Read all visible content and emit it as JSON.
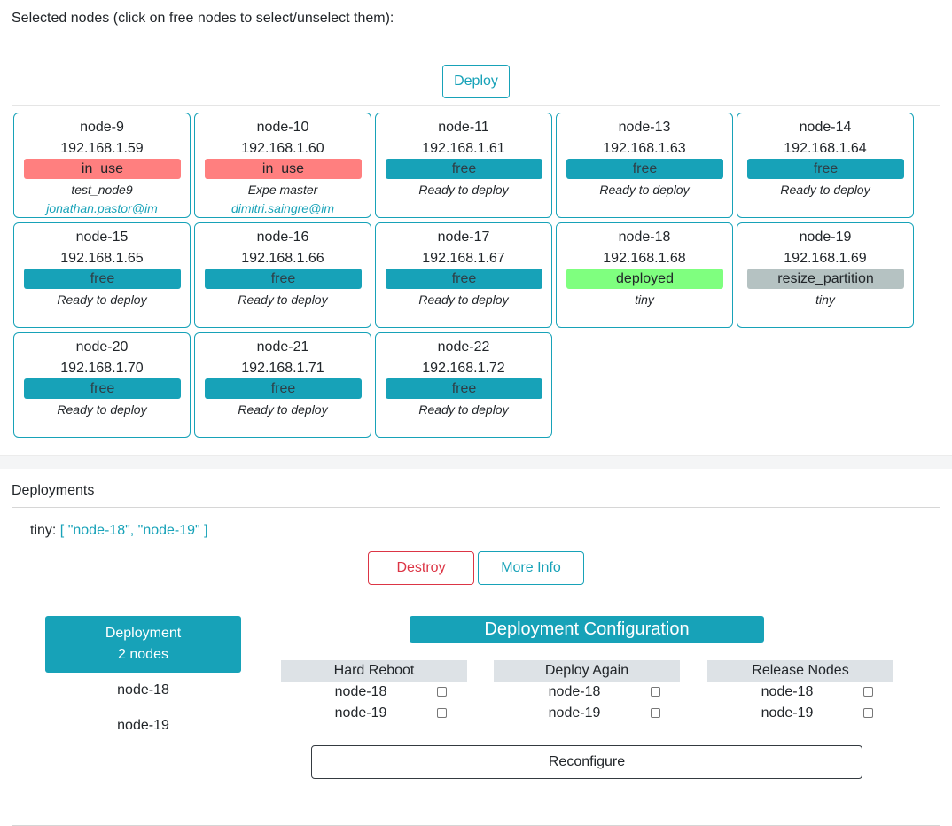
{
  "selection": {
    "hint": "Selected nodes (click on free nodes to select/unselect them):",
    "deploy_label": "Deploy"
  },
  "nodes": [
    {
      "name": "node-9",
      "ip": "192.168.1.59",
      "state": "in_use",
      "desc": "test_node9",
      "user": "jonathan.pastor@im"
    },
    {
      "name": "node-10",
      "ip": "192.168.1.60",
      "state": "in_use",
      "desc": "Expe master",
      "user": "dimitri.saingre@im"
    },
    {
      "name": "node-11",
      "ip": "192.168.1.61",
      "state": "free",
      "desc": "Ready to deploy",
      "user": ""
    },
    {
      "name": "node-13",
      "ip": "192.168.1.63",
      "state": "free",
      "desc": "Ready to deploy",
      "user": ""
    },
    {
      "name": "node-14",
      "ip": "192.168.1.64",
      "state": "free",
      "desc": "Ready to deploy",
      "user": ""
    },
    {
      "name": "node-15",
      "ip": "192.168.1.65",
      "state": "free",
      "desc": "Ready to deploy",
      "user": ""
    },
    {
      "name": "node-16",
      "ip": "192.168.1.66",
      "state": "free",
      "desc": "Ready to deploy",
      "user": ""
    },
    {
      "name": "node-17",
      "ip": "192.168.1.67",
      "state": "free",
      "desc": "Ready to deploy",
      "user": ""
    },
    {
      "name": "node-18",
      "ip": "192.168.1.68",
      "state": "deployed",
      "desc": "tiny",
      "user": ""
    },
    {
      "name": "node-19",
      "ip": "192.168.1.69",
      "state": "resize_partition",
      "desc": "tiny",
      "user": ""
    },
    {
      "name": "node-20",
      "ip": "192.168.1.70",
      "state": "free",
      "desc": "Ready to deploy",
      "user": ""
    },
    {
      "name": "node-21",
      "ip": "192.168.1.71",
      "state": "free",
      "desc": "Ready to deploy",
      "user": ""
    },
    {
      "name": "node-22",
      "ip": "192.168.1.72",
      "state": "free",
      "desc": "Ready to deploy",
      "user": ""
    }
  ],
  "deployments": {
    "title": "Deployments",
    "entry": {
      "name": "tiny:",
      "nodes_text": "[ \"node-18\", \"node-19\" ]"
    },
    "destroy_label": "Destroy",
    "more_info_label": "More Info",
    "summary": {
      "line1": "Deployment",
      "line2": "2 nodes"
    },
    "nodes": [
      "node-18",
      "node-19"
    ],
    "config": {
      "title": "Deployment Configuration",
      "columns": [
        {
          "title": "Hard Reboot",
          "rows": [
            "node-18",
            "node-19"
          ]
        },
        {
          "title": "Deploy Again",
          "rows": [
            "node-18",
            "node-19"
          ]
        },
        {
          "title": "Release Nodes",
          "rows": [
            "node-18",
            "node-19"
          ]
        }
      ],
      "reconfigure_label": "Reconfigure"
    }
  }
}
